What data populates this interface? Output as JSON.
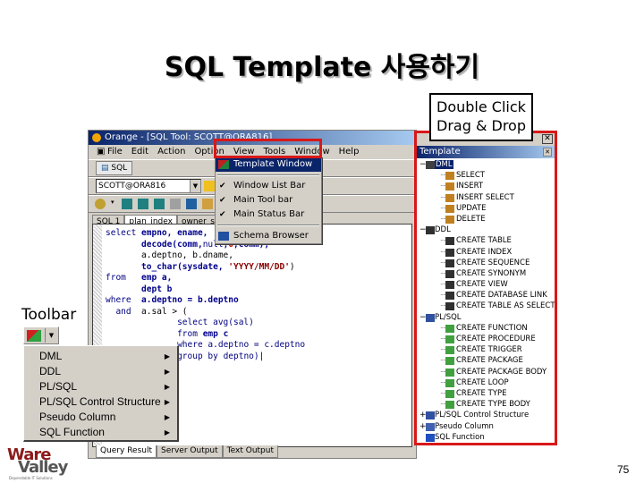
{
  "slide": {
    "title": "SQL Template 사용하기",
    "callout_lines": [
      "Double Click",
      "Drag & Drop"
    ],
    "toolbar_label": "Toolbar",
    "page_number": "75",
    "logo": {
      "line1": "Ware",
      "line2": "Valley",
      "tagline": "Dependable IT Solutions"
    },
    "highlight_color": "#d81818"
  },
  "app": {
    "window_title": "Orange - [SQL Tool: SCOTT@ORA816]",
    "menu": [
      "File",
      "Edit",
      "Action",
      "Option",
      "View",
      "Tools",
      "Window",
      "Help"
    ],
    "sql_button": "SQL",
    "connection": "SCOTT@ORA816",
    "editor_tabs": [
      "SQL 1",
      "plan_index",
      "owner_sync"
    ],
    "code_lines": [
      [
        {
          "t": "select ",
          "c": "kw2"
        },
        {
          "t": "empno, ename, ",
          "c": "kw"
        }
      ],
      [
        {
          "t": "       "
        },
        {
          "t": "decode(comm,",
          "c": "kw"
        },
        {
          "t": "null",
          "c": "kw2"
        },
        {
          "t": ",",
          "c": "kw"
        },
        {
          "t": "0",
          "c": "num"
        },
        {
          "t": ",comm),",
          "c": "kw"
        }
      ],
      [
        {
          "t": "       a.deptno, b.dname,"
        }
      ],
      [
        {
          "t": "       "
        },
        {
          "t": "to_char(sysdate, ",
          "c": "kw"
        },
        {
          "t": "'YYYY/MM/DD'",
          "c": "str"
        },
        {
          "t": ")"
        }
      ],
      [
        {
          "t": "from   ",
          "c": "kw2"
        },
        {
          "t": "emp a,",
          "c": "kw"
        }
      ],
      [
        {
          "t": "       "
        },
        {
          "t": "dept b",
          "c": "kw"
        }
      ],
      [
        {
          "t": "where  ",
          "c": "kw2"
        },
        {
          "t": "a.deptno = b.deptno",
          "c": "kw"
        }
      ],
      [
        {
          "t": "  and  ",
          "c": "kw2"
        },
        {
          "t": "a.sal > ("
        }
      ],
      [
        {
          "t": "              "
        },
        {
          "t": "select avg(sal)",
          "c": "kw2"
        }
      ],
      [
        {
          "t": "              "
        },
        {
          "t": "from ",
          "c": "kw2"
        },
        {
          "t": "emp c",
          "c": "kw"
        }
      ],
      [
        {
          "t": "              "
        },
        {
          "t": "where ",
          "c": "kw2"
        },
        {
          "t": "a.deptno = c.deptno",
          "c": "kw2"
        }
      ],
      [
        {
          "t": "              "
        },
        {
          "t": "group by ",
          "c": "kw2"
        },
        {
          "t": "deptno)",
          "c": "kw2"
        }
      ]
    ],
    "bottom_tabs": [
      "Query Result",
      "Server Output",
      "Text Output"
    ]
  },
  "view_menu": {
    "items": [
      {
        "label": "Template Window",
        "selected": true,
        "checked": false,
        "icon": "template-icon"
      },
      {
        "separator": true
      },
      {
        "label": "Window List Bar",
        "checked": true
      },
      {
        "label": "Main Tool bar",
        "checked": true
      },
      {
        "label": "Main Status Bar",
        "checked": true
      },
      {
        "separator": true
      },
      {
        "label": "Schema Browser",
        "checked": false,
        "icon": "schema-browser-icon"
      }
    ]
  },
  "template_window": {
    "title": "Template",
    "tree": [
      {
        "label": "DML",
        "level": 0,
        "expanded": true,
        "selected": true,
        "icon": "dml-icon"
      },
      {
        "label": "SELECT",
        "level": 1,
        "icon": "template-doc-icon"
      },
      {
        "label": "INSERT",
        "level": 1,
        "icon": "template-doc-icon"
      },
      {
        "label": "INSERT SELECT",
        "level": 1,
        "icon": "template-doc-icon"
      },
      {
        "label": "UPDATE",
        "level": 1,
        "icon": "template-doc-icon"
      },
      {
        "label": "DELETE",
        "level": 1,
        "icon": "template-doc-icon"
      },
      {
        "label": "DDL",
        "level": 0,
        "expanded": true,
        "icon": "hammer-icon"
      },
      {
        "label": "CREATE TABLE",
        "level": 1,
        "icon": "hammer-icon"
      },
      {
        "label": "CREATE INDEX",
        "level": 1,
        "icon": "hammer-icon"
      },
      {
        "label": "CREATE SEQUENCE",
        "level": 1,
        "icon": "hammer-icon"
      },
      {
        "label": "CREATE SYNONYM",
        "level": 1,
        "icon": "hammer-icon"
      },
      {
        "label": "CREATE VIEW",
        "level": 1,
        "icon": "hammer-icon"
      },
      {
        "label": "CREATE DATABASE LINK",
        "level": 1,
        "icon": "hammer-icon"
      },
      {
        "label": "CREATE TABLE AS SELECT",
        "level": 1,
        "icon": "hammer-icon"
      },
      {
        "label": "PL/SQL",
        "level": 0,
        "expanded": true,
        "icon": "plsql-icon"
      },
      {
        "label": "CREATE FUNCTION",
        "level": 1,
        "icon": "plsql-object-icon"
      },
      {
        "label": "CREATE PROCEDURE",
        "level": 1,
        "icon": "plsql-object-icon"
      },
      {
        "label": "CREATE TRIGGER",
        "level": 1,
        "icon": "plsql-object-icon"
      },
      {
        "label": "CREATE PACKAGE",
        "level": 1,
        "icon": "plsql-object-icon"
      },
      {
        "label": "CREATE PACKAGE BODY",
        "level": 1,
        "icon": "plsql-object-icon"
      },
      {
        "label": "CREATE LOOP",
        "level": 1,
        "icon": "plsql-object-icon"
      },
      {
        "label": "CREATE TYPE",
        "level": 1,
        "icon": "plsql-object-icon"
      },
      {
        "label": "CREATE TYPE BODY",
        "level": 1,
        "icon": "plsql-object-icon"
      },
      {
        "label": "PL/SQL Control Structure",
        "level": 0,
        "expanded": false,
        "icon": "plsql-icon"
      },
      {
        "label": "Pseudo Column",
        "level": 0,
        "expanded": false,
        "icon": "pseudo-column-icon"
      },
      {
        "label": "SQL Function",
        "level": 0,
        "expanded": null,
        "icon": "function-icon"
      }
    ]
  },
  "toolbar_popup": {
    "items": [
      "DML",
      "DDL",
      "PL/SQL",
      "PL/SQL Control Structure",
      "Pseudo Column",
      "SQL Function"
    ]
  }
}
